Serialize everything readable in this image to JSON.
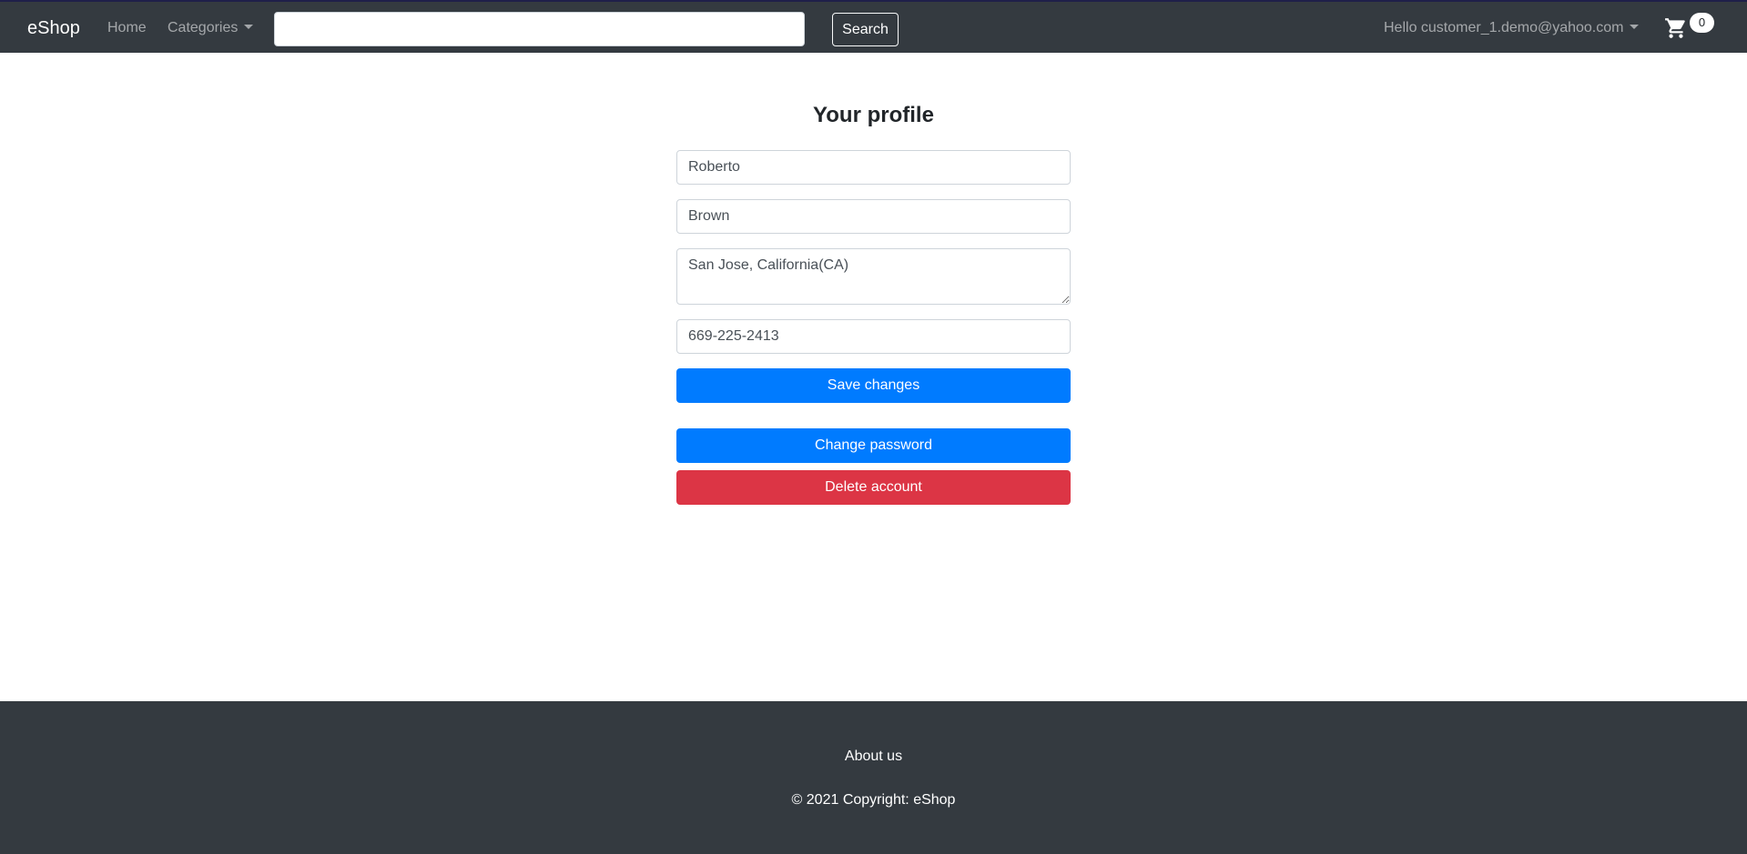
{
  "navbar": {
    "brand": "eShop",
    "home_label": "Home",
    "categories_label": "Categories",
    "search": {
      "value": "",
      "placeholder": ""
    },
    "search_button_label": "Search",
    "user_menu_label": "Hello customer_1.demo@yahoo.com",
    "cart_count": "0"
  },
  "profile": {
    "title": "Your profile",
    "first_name": "Roberto",
    "last_name": "Brown",
    "address": "San Jose, California(CA)",
    "phone": "669-225-2413",
    "save_label": "Save changes",
    "change_password_label": "Change password",
    "delete_account_label": "Delete account"
  },
  "footer": {
    "about_label": "About us",
    "copyright": "© 2021 Copyright: eShop"
  },
  "colors": {
    "navbar_bg": "#343a40",
    "primary": "#007bff",
    "danger": "#dc3545"
  },
  "icons": {
    "cart": "shopping-cart-icon",
    "dropdown": "caret-down-icon"
  }
}
